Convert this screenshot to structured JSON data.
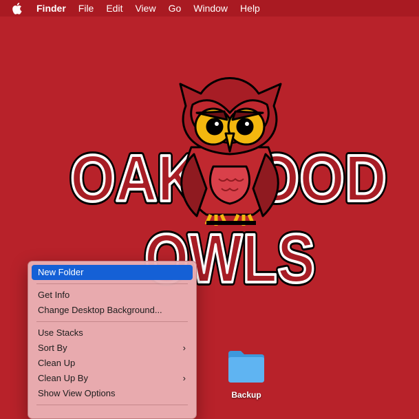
{
  "menubar": {
    "apple_icon": "apple-logo-icon",
    "items": [
      "Finder",
      "File",
      "Edit",
      "View",
      "Go",
      "Window",
      "Help"
    ]
  },
  "wallpaper": {
    "line1": "OAKWOOD",
    "line2": "OWLS",
    "colors": {
      "background": "#b8222a",
      "letter_fill": "#a71d25",
      "letter_outline": "#ffffff",
      "owl_body": "#c0282f",
      "owl_eye": "#f3b70f"
    }
  },
  "context_menu": {
    "items": [
      {
        "label": "New Folder",
        "highlighted": true
      },
      {
        "label": "Get Info"
      },
      {
        "label": "Change Desktop Background..."
      },
      {
        "label": "Use Stacks"
      },
      {
        "label": "Sort By",
        "submenu": true
      },
      {
        "label": "Clean Up"
      },
      {
        "label": "Clean Up By",
        "submenu": true
      },
      {
        "label": "Show View Options"
      }
    ],
    "submenu_glyph": "›"
  },
  "desktop": {
    "folder": {
      "name": "Backup",
      "icon": "folder-icon",
      "color": "#5fb4f2"
    }
  }
}
